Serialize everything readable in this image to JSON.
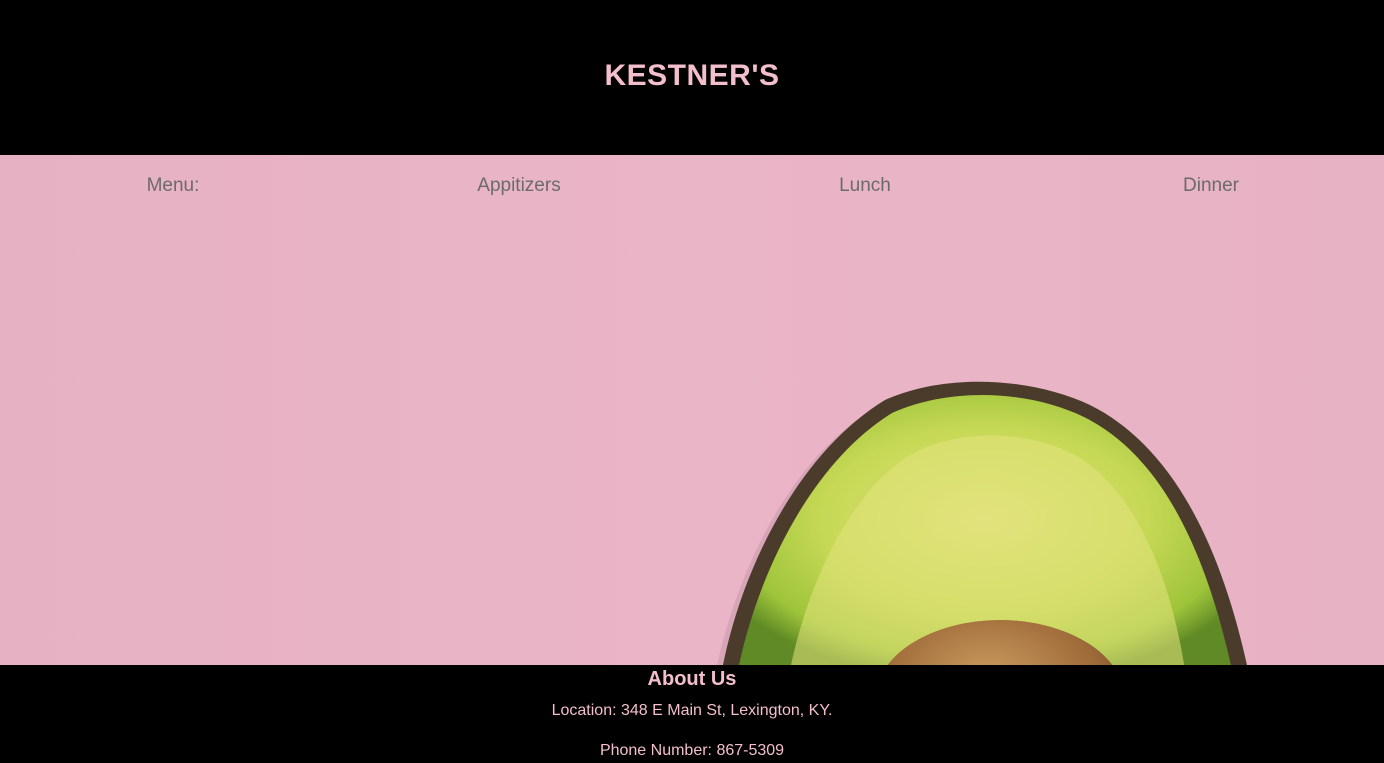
{
  "header": {
    "title": "KESTNER'S"
  },
  "menu": {
    "label": "Menu:",
    "items": [
      "Appitizers",
      "Lunch",
      "Dinner"
    ]
  },
  "hero": {
    "image": "pink-background-avocado-half"
  },
  "footer": {
    "about_title": "About Us",
    "location": "Location: 348 E Main St, Lexington, KY.",
    "phone": "Phone Number: 867-5309"
  },
  "colors": {
    "accent_pink": "#f4bfcc",
    "hero_background": "#e9b4c6",
    "menu_text": "#6b6b6b",
    "header_background": "#000000"
  }
}
